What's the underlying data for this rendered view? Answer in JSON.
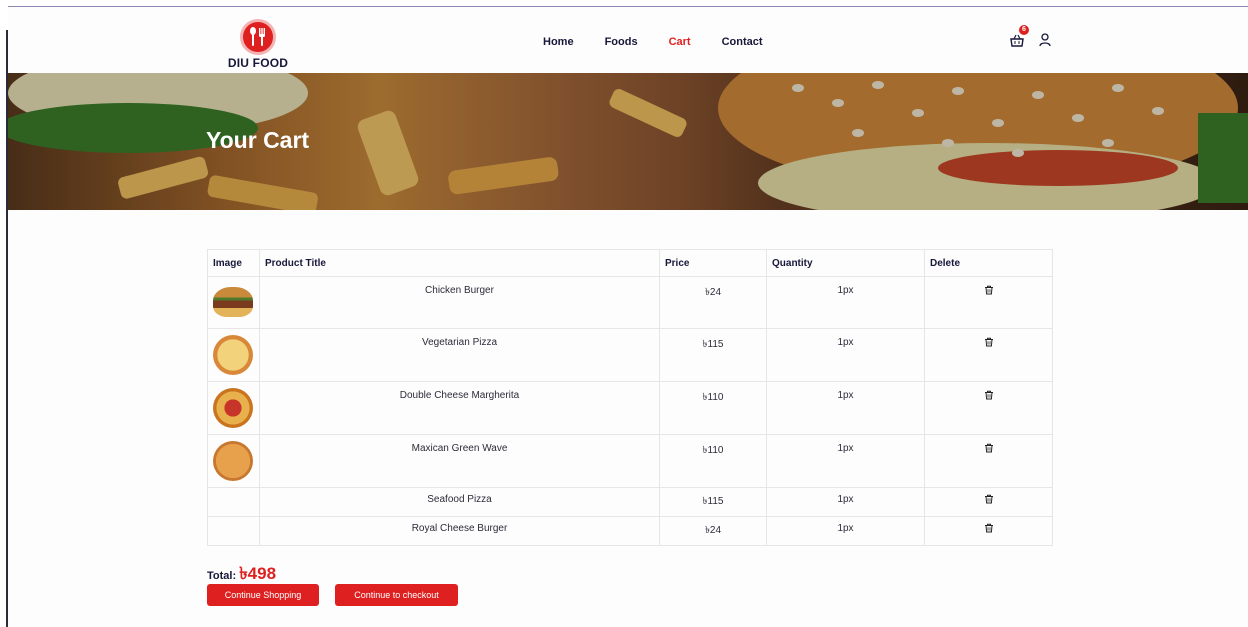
{
  "brand": {
    "name": "DIU FOOD",
    "accent": "#df2020"
  },
  "nav": {
    "items": [
      "Home",
      "Foods",
      "Cart",
      "Contact"
    ],
    "active": "Cart"
  },
  "header_icons": {
    "cart_count": "6",
    "cart_icon": "shopping-basket-icon",
    "user_icon": "user-icon"
  },
  "hero": {
    "title": "Your Cart"
  },
  "table": {
    "headers": [
      "Image",
      "Product Title",
      "Price",
      "Quantity",
      "Delete"
    ],
    "rows": [
      {
        "title": "Chicken Burger",
        "price": "৳24",
        "qty": "1px",
        "image": "burger"
      },
      {
        "title": "Vegetarian Pizza",
        "price": "৳115",
        "qty": "1px",
        "image": "pizza"
      },
      {
        "title": "Double Cheese Margherita",
        "price": "৳110",
        "qty": "1px",
        "image": "pizza"
      },
      {
        "title": "Maxican Green Wave",
        "price": "৳110",
        "qty": "1px",
        "image": "pizza"
      },
      {
        "title": "Seafood Pizza",
        "price": "৳115",
        "qty": "1px",
        "image": ""
      },
      {
        "title": "Royal Cheese Burger",
        "price": "৳24",
        "qty": "1px",
        "image": ""
      }
    ]
  },
  "summary": {
    "total_label": "Total:",
    "total_value": "৳498"
  },
  "actions": {
    "continue_shopping": "Continue Shopping",
    "checkout": "Continue to checkout"
  }
}
